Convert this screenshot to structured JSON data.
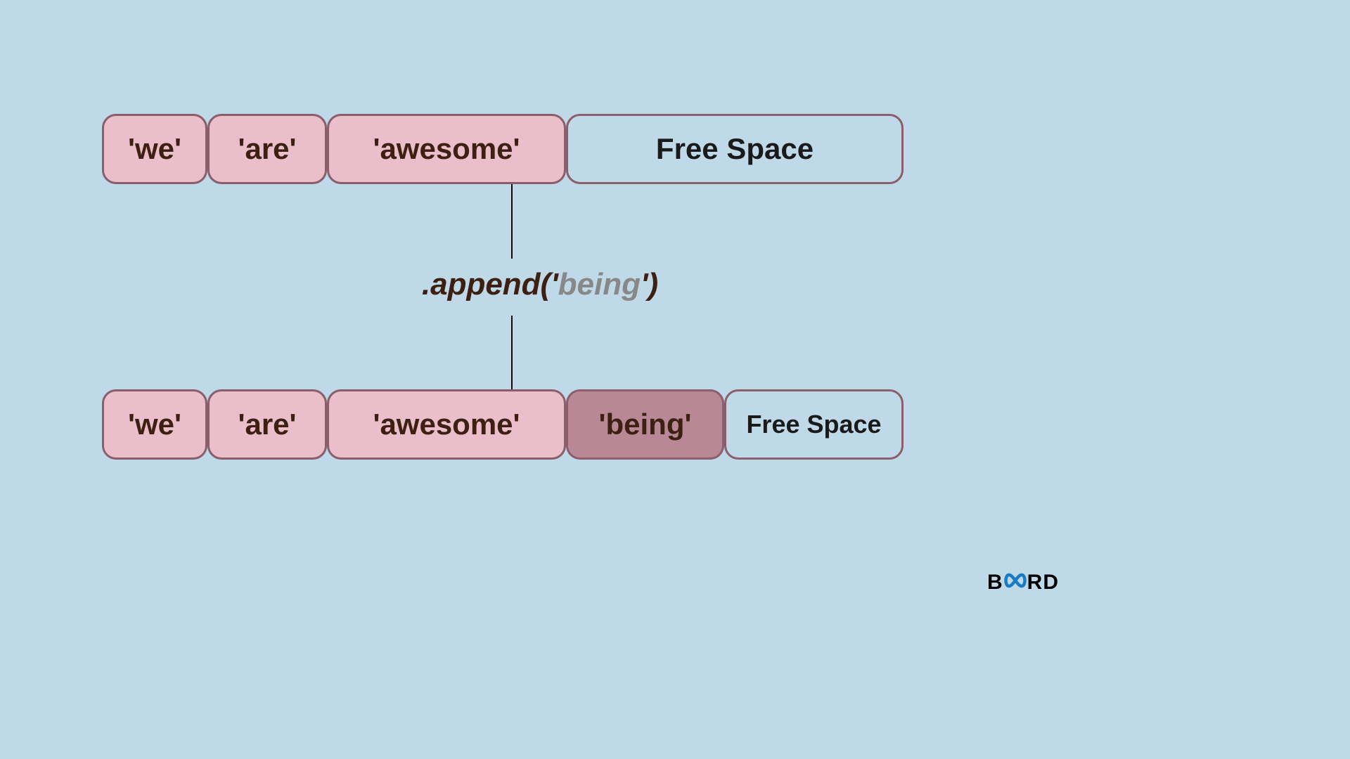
{
  "row_before": {
    "items": [
      {
        "label": "'we'",
        "style": "pink",
        "w": "w-we"
      },
      {
        "label": "'are'",
        "style": "pink",
        "w": "w-are"
      },
      {
        "label": "'awesome'",
        "style": "pink",
        "w": "w-awesome"
      },
      {
        "label": "Free Space",
        "style": "free",
        "w": "w-free-big"
      }
    ]
  },
  "row_after": {
    "items": [
      {
        "label": "'we'",
        "style": "pink",
        "w": "w-we"
      },
      {
        "label": "'are'",
        "style": "pink",
        "w": "w-are"
      },
      {
        "label": "'awesome'",
        "style": "pink",
        "w": "w-awesome"
      },
      {
        "label": "'being'",
        "style": "darkpink",
        "w": "w-being"
      },
      {
        "label": "Free Space",
        "style": "free",
        "w": "w-free-small"
      }
    ]
  },
  "operation": {
    "prefix": ".append('",
    "arg": "being",
    "suffix": "')"
  },
  "logo": {
    "b": "B",
    "infinity": "∞",
    "rd": "RD"
  }
}
